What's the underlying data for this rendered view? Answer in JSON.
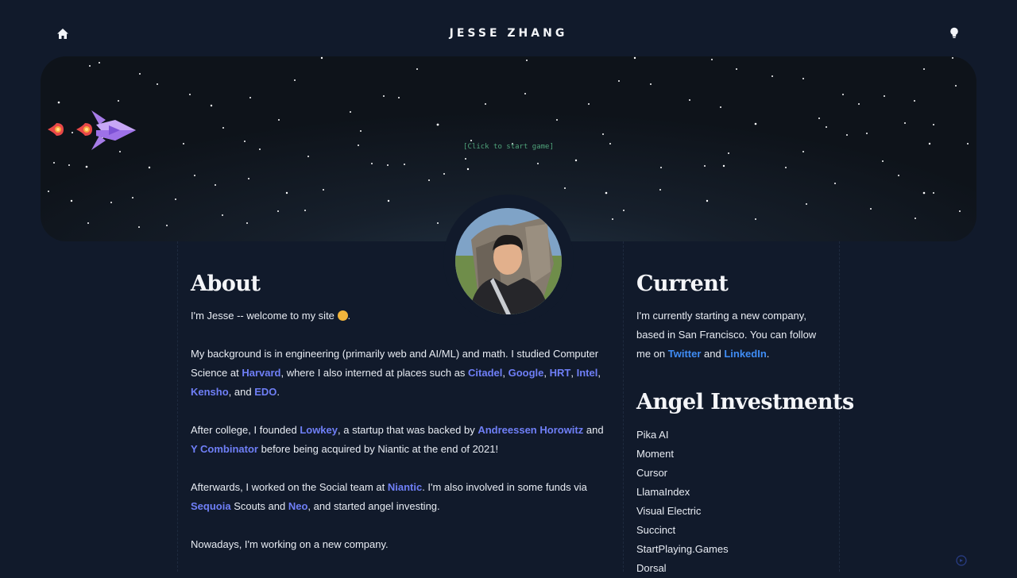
{
  "header": {
    "title": "JESSE ZHANG",
    "home_icon": "home-icon",
    "theme_icon": "lightbulb-icon"
  },
  "hero": {
    "prompt": "[Click to start game]",
    "ship_icon": "spaceship-icon"
  },
  "about": {
    "heading": "About",
    "p1_a": "I'm Jesse -- welcome to my site ",
    "p1_b": ".",
    "p2_a": "My background is in engineering (primarily web and AI/ML) and math. I studied Computer Science at ",
    "harvard": "Harvard",
    "p2_b": ", where I also interned at places such as ",
    "citadel": "Citadel",
    "google": "Google",
    "hrt": "HRT",
    "intel": "Intel",
    "kensho": "Kensho",
    "p2_c": ", and ",
    "edo": "EDO",
    "p3_a": "After college, I founded ",
    "lowkey": "Lowkey",
    "p3_b": ", a startup that was backed by ",
    "a16z": "Andreessen Horowitz",
    "p3_c": " and ",
    "yc": "Y Combinator",
    "p3_d": " before being acquired by Niantic at the end of 2021!",
    "p4_a": "Afterwards, I worked on the Social team at ",
    "niantic": "Niantic",
    "p4_b": ". I'm also involved in some funds via ",
    "sequoia": "Sequoia",
    "p4_c": " Scouts and ",
    "neo": "Neo",
    "p4_d": ", and started angel investing.",
    "p5": "Nowadays, I'm working on a new company."
  },
  "current": {
    "heading": "Current",
    "text_a": "I'm currently starting a new company, based in San Francisco. You can follow me on ",
    "twitter": "Twitter",
    "text_b": " and ",
    "linkedin": "LinkedIn",
    "text_c": "."
  },
  "angel": {
    "heading": "Angel Investments",
    "items": [
      "Pika AI",
      "Moment",
      "Cursor",
      "LlamaIndex",
      "Visual Electric",
      "Succinct",
      "StartPlaying.Games",
      "Dorsal"
    ]
  },
  "colors": {
    "background": "#111a2b",
    "link": "#6f7ff7",
    "link_alt": "#3f8cf4",
    "prompt": "#4fa37a"
  }
}
